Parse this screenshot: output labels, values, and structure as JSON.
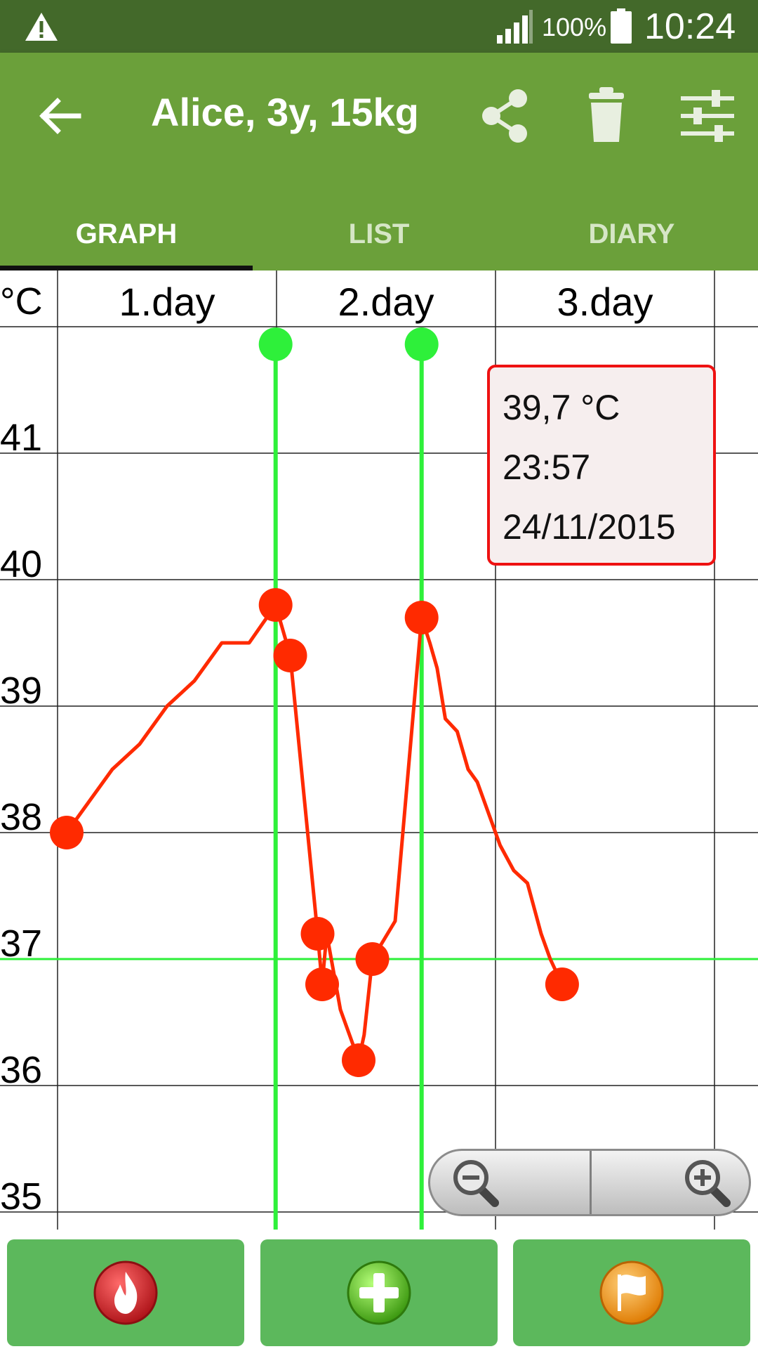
{
  "status_bar": {
    "warning_icon": "warning-icon",
    "signal_icon": "signal-icon",
    "battery_percent": "100%",
    "battery_icon": "battery-icon",
    "time": "10:24"
  },
  "app_bar": {
    "back_icon": "arrow-left-icon",
    "title": "Alice, 3y, 15kg",
    "actions": [
      "share-icon",
      "trash-icon",
      "sliders-icon"
    ],
    "accent_color": "#6ba03a"
  },
  "tabs": [
    {
      "label": "GRAPH",
      "selected": true
    },
    {
      "label": "LIST",
      "selected": false
    },
    {
      "label": "DIARY",
      "selected": false
    }
  ],
  "chart_data": {
    "type": "line",
    "y_unit_label": "°C",
    "y_ticks": [
      "41",
      "40",
      "39",
      "38",
      "37",
      "36",
      "35"
    ],
    "ylim": [
      35,
      42
    ],
    "x_day_labels": [
      "1.day",
      "2.day",
      "3.day"
    ],
    "reference_line_y": 37,
    "series": [
      {
        "color": "#ff2a00",
        "x_hours": [
          1,
          3,
          6,
          9,
          12,
          15,
          18,
          21,
          23.9,
          25.5,
          28.5,
          29,
          29.5,
          31,
          33,
          33.6,
          34.5,
          37,
          39.9,
          40.8,
          41.6,
          42.5,
          43.8,
          45,
          46,
          47.5,
          48.5,
          50,
          51.5,
          53,
          54,
          55.3
        ],
        "y": [
          38.0,
          38.2,
          38.5,
          38.7,
          39.0,
          39.2,
          39.5,
          39.5,
          39.8,
          39.4,
          37.2,
          36.8,
          37.2,
          36.6,
          36.2,
          36.4,
          37.0,
          37.3,
          39.7,
          39.5,
          39.3,
          38.9,
          38.8,
          38.5,
          38.4,
          38.1,
          37.9,
          37.7,
          37.6,
          37.2,
          37.0,
          36.8
        ],
        "marker_indices": [
          0,
          8,
          9,
          10,
          11,
          14,
          16,
          18,
          31
        ]
      }
    ],
    "vertical_markers_x_hours": [
      23.9,
      39.9
    ],
    "tooltip": {
      "lines": [
        "39,7 °C",
        "23:57",
        "24/11/2015"
      ]
    },
    "grid": true,
    "legend": "none"
  },
  "zoom": {
    "zoom_out_icon": "zoom-out-icon",
    "zoom_in_icon": "zoom-in-icon"
  },
  "bottom_actions": [
    {
      "icon": "flame-icon",
      "color": "#d32f2f"
    },
    {
      "icon": "plus-icon",
      "color": "#5fcf1f"
    },
    {
      "icon": "flag-icon",
      "color": "#f39a1e"
    }
  ]
}
